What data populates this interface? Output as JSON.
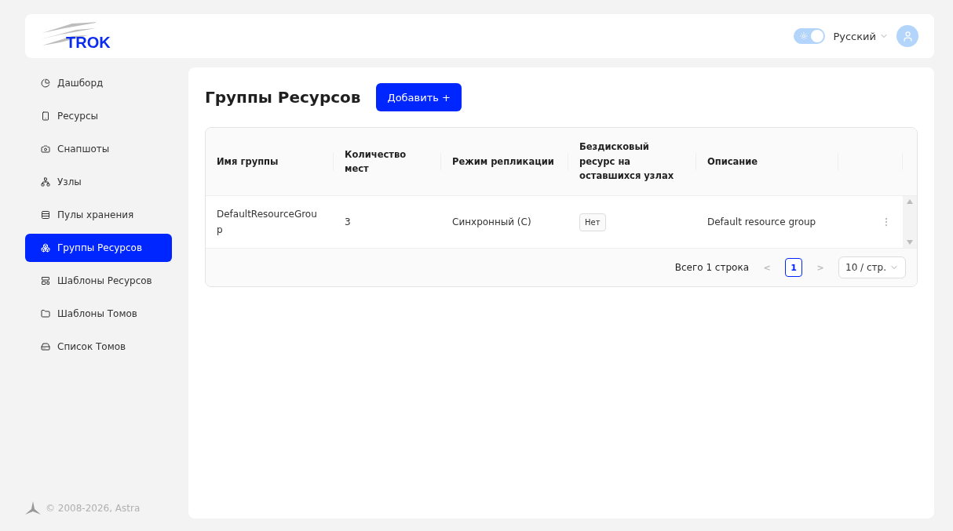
{
  "header": {
    "logo": "TROK",
    "theme_switch": {
      "on": true
    },
    "language": "Русский"
  },
  "sidebar": {
    "items": [
      {
        "label": "Дашборд",
        "selected": false
      },
      {
        "label": "Ресурсы",
        "selected": false
      },
      {
        "label": "Снапшоты",
        "selected": false
      },
      {
        "label": "Узлы",
        "selected": false
      },
      {
        "label": "Пулы хранения",
        "selected": false
      },
      {
        "label": "Группы Ресурсов",
        "selected": true
      },
      {
        "label": "Шаблоны Ресурсов",
        "selected": false
      },
      {
        "label": "Шаблоны Томов",
        "selected": false
      },
      {
        "label": "Список Томов",
        "selected": false
      }
    ],
    "footer": "© 2008-2026, Astra"
  },
  "page": {
    "title": "Группы Ресурсов",
    "add_button": "Добавить +"
  },
  "table": {
    "columns": [
      "Имя группы",
      "Количество мест",
      "Режим репликации",
      "Бездисковый ресурс на оставшихся узлах",
      "Описание"
    ],
    "rows": [
      {
        "cells": [
          "DefaultResourceGroup",
          "3",
          "Синхронный (C)",
          "Нет",
          "Default resource group"
        ]
      }
    ]
  },
  "pagination": {
    "total": "Всего 1 строка",
    "prev": "<",
    "pages": [
      {
        "label": "1",
        "selected": true
      }
    ],
    "next": ">",
    "page_size": "10 / стр."
  }
}
